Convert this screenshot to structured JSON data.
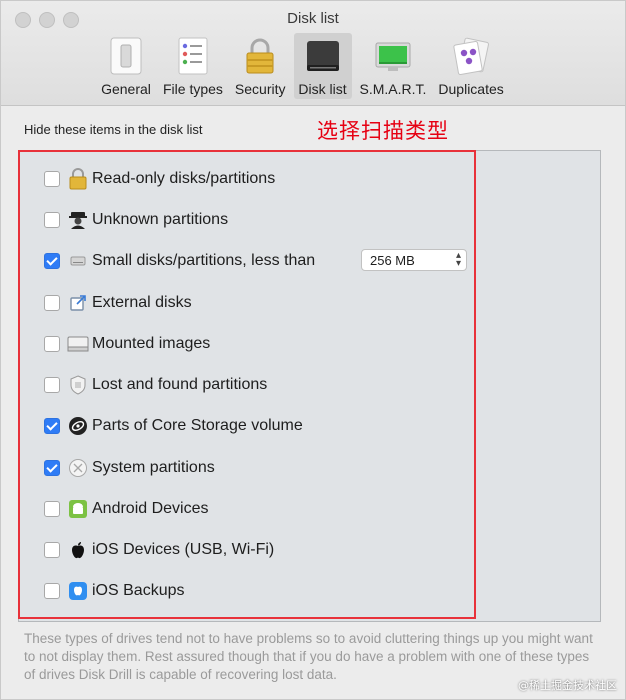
{
  "window": {
    "title": "Disk list"
  },
  "toolbar": {
    "tabs": [
      {
        "label": "General",
        "icon": "general-icon"
      },
      {
        "label": "File types",
        "icon": "file-types-icon"
      },
      {
        "label": "Security",
        "icon": "lock-icon"
      },
      {
        "label": "Disk list",
        "icon": "disk-icon",
        "selected": true
      },
      {
        "label": "S.M.A.R.T.",
        "icon": "smart-monitor-icon"
      },
      {
        "label": "Duplicates",
        "icon": "duplicates-icon"
      }
    ]
  },
  "section": {
    "label": "Hide these items in the disk list",
    "annotation": "选择扫描类型"
  },
  "items": [
    {
      "label": "Read-only disks/partitions",
      "checked": false,
      "icon": "lock-icon"
    },
    {
      "label": "Unknown partitions",
      "checked": false,
      "icon": "spy-icon"
    },
    {
      "label": "Small disks/partitions, less than",
      "checked": true,
      "icon": "small-disk-icon"
    },
    {
      "label": "External disks",
      "checked": false,
      "icon": "external-disk-icon"
    },
    {
      "label": "Mounted images",
      "checked": false,
      "icon": "mounted-image-icon"
    },
    {
      "label": "Lost and found partitions",
      "checked": false,
      "icon": "lost-found-icon"
    },
    {
      "label": "Parts of Core Storage volume",
      "checked": true,
      "icon": "core-storage-icon"
    },
    {
      "label": "System partitions",
      "checked": true,
      "icon": "system-partition-icon"
    },
    {
      "label": "Android Devices",
      "checked": false,
      "icon": "android-icon"
    },
    {
      "label": "iOS Devices (USB, Wi-Fi)",
      "checked": false,
      "icon": "apple-icon"
    },
    {
      "label": "iOS Backups",
      "checked": false,
      "icon": "ios-backup-icon"
    }
  ],
  "size_select": {
    "value": "256 MB"
  },
  "footer": {
    "text": "These types of drives tend not to have problems so to avoid cluttering things up you might want to not display them. Rest assured though that if you do have a problem with one of these types of drives Disk Drill is capable of recovering lost data."
  },
  "watermark": {
    "text": "@稀土掘金技术社区"
  },
  "colors": {
    "accent": "#2f7cf6",
    "annotation": "#e60012",
    "highlight_box": "#e8313a"
  }
}
